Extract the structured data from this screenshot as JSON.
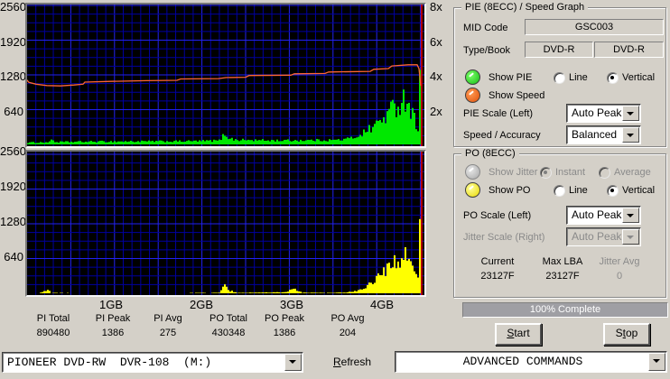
{
  "window": {
    "bg": "#d4d0c8",
    "accent_green": "#00e800",
    "accent_yellow": "#ffff00",
    "speed_line_color": "#ff6633",
    "cursor_color": "#dd0000"
  },
  "chart_data": [
    {
      "id": "pie_speed_graph",
      "type": "bar+line",
      "title": "PIE (8ECC) / Speed Graph",
      "bg": "#000000",
      "grid": {
        "on": true,
        "minor_color": "#0000a0",
        "major_color": "#2222f0"
      },
      "x_axis": {
        "unit": "GB",
        "range": [
          0,
          4.45
        ],
        "ticks": [
          "1GB",
          "2GB",
          "3GB",
          "4GB"
        ],
        "tick_values": [
          1,
          2,
          3,
          4
        ]
      },
      "left_axis": {
        "series": "PIE",
        "range": [
          0,
          2560
        ],
        "ticks": [
          2560,
          1920,
          1280,
          640
        ]
      },
      "right_axis": {
        "series": "Speed",
        "range": [
          2,
          8
        ],
        "ticks": [
          "8x",
          "6x",
          "4x",
          "2x"
        ]
      },
      "cursor_gb": 4.45,
      "bars": {
        "name": "PIE",
        "color": "#00e800",
        "peak": 1386,
        "keypoints_gb_value": [
          [
            0,
            25
          ],
          [
            0.05,
            35
          ],
          [
            0.25,
            40
          ],
          [
            0.32,
            45
          ],
          [
            0.35,
            115
          ],
          [
            0.38,
            45
          ],
          [
            0.6,
            50
          ],
          [
            0.9,
            55
          ],
          [
            1.3,
            58
          ],
          [
            1.7,
            60
          ],
          [
            2.0,
            65
          ],
          [
            2.2,
            75
          ],
          [
            2.26,
            200
          ],
          [
            2.3,
            140
          ],
          [
            2.36,
            90
          ],
          [
            2.6,
            80
          ],
          [
            2.9,
            75
          ],
          [
            3.2,
            80
          ],
          [
            3.5,
            85
          ],
          [
            3.6,
            100
          ],
          [
            3.7,
            140
          ],
          [
            3.8,
            230
          ],
          [
            3.9,
            340
          ],
          [
            4.0,
            480
          ],
          [
            4.1,
            650
          ],
          [
            4.2,
            830
          ],
          [
            4.27,
            900
          ],
          [
            4.31,
            760
          ],
          [
            4.35,
            520
          ],
          [
            4.39,
            360
          ],
          [
            4.41,
            340
          ],
          [
            4.418,
            1386
          ],
          [
            4.428,
            1386
          ],
          [
            4.434,
            700
          ],
          [
            4.44,
            60
          ]
        ]
      },
      "line": {
        "name": "Speed",
        "color": "#ff6633",
        "points_gb_speed": [
          [
            0,
            4.65
          ],
          [
            0.02,
            4.3
          ],
          [
            0.05,
            3.9
          ],
          [
            0.1,
            3.6
          ],
          [
            0.18,
            3.5
          ],
          [
            0.3,
            3.42
          ],
          [
            0.45,
            3.4
          ],
          [
            0.6,
            3.45
          ],
          [
            0.7,
            3.5
          ],
          [
            0.72,
            3.62
          ],
          [
            1.0,
            3.66
          ],
          [
            1.4,
            3.7
          ],
          [
            1.74,
            3.72
          ],
          [
            1.78,
            3.8
          ],
          [
            2.2,
            3.82
          ],
          [
            2.28,
            3.88
          ],
          [
            2.5,
            3.9
          ],
          [
            2.54,
            4.0
          ],
          [
            3.0,
            4.02
          ],
          [
            3.04,
            4.1
          ],
          [
            3.38,
            4.12
          ],
          [
            3.42,
            4.2
          ],
          [
            3.88,
            4.24
          ],
          [
            3.92,
            4.36
          ],
          [
            4.08,
            4.4
          ],
          [
            4.12,
            4.55
          ],
          [
            4.3,
            4.62
          ],
          [
            4.4,
            4.62
          ],
          [
            4.42,
            4.4
          ],
          [
            4.44,
            3.4
          ]
        ]
      }
    },
    {
      "id": "po_graph",
      "type": "bar",
      "title": "PO (8ECC)",
      "bg": "#000000",
      "grid": {
        "on": true,
        "minor_color": "#0000a0",
        "major_color": "#2222f0"
      },
      "x_axis": {
        "unit": "GB",
        "range": [
          0,
          4.45
        ],
        "ticks": [
          "1GB",
          "2GB",
          "3GB",
          "4GB"
        ],
        "tick_values": [
          1,
          2,
          3,
          4
        ]
      },
      "left_axis": {
        "series": "PO",
        "range": [
          0,
          2560
        ],
        "ticks": [
          2560,
          1920,
          1280,
          640
        ]
      },
      "cursor_gb": 4.45,
      "bars": {
        "name": "PO",
        "color": "#ffff00",
        "peak": 1386,
        "keypoints_gb_value": [
          [
            0,
            3
          ],
          [
            0.2,
            4
          ],
          [
            0.28,
            55
          ],
          [
            0.31,
            60
          ],
          [
            0.34,
            8
          ],
          [
            0.7,
            3
          ],
          [
            1.2,
            4
          ],
          [
            1.8,
            5
          ],
          [
            2.2,
            10
          ],
          [
            2.26,
            150
          ],
          [
            2.3,
            60
          ],
          [
            2.4,
            8
          ],
          [
            2.95,
            20
          ],
          [
            3.0,
            95
          ],
          [
            3.06,
            55
          ],
          [
            3.12,
            12
          ],
          [
            3.4,
            8
          ],
          [
            3.6,
            15
          ],
          [
            3.7,
            40
          ],
          [
            3.8,
            95
          ],
          [
            3.9,
            215
          ],
          [
            4.0,
            360
          ],
          [
            4.1,
            500
          ],
          [
            4.2,
            660
          ],
          [
            4.27,
            780
          ],
          [
            4.31,
            630
          ],
          [
            4.35,
            430
          ],
          [
            4.39,
            260
          ],
          [
            4.41,
            230
          ],
          [
            4.418,
            1386
          ],
          [
            4.428,
            1386
          ],
          [
            4.434,
            550
          ],
          [
            4.44,
            15
          ]
        ]
      }
    }
  ],
  "stats": {
    "items": [
      {
        "label": "PI Total",
        "value": "890480"
      },
      {
        "label": "PI Peak",
        "value": "1386"
      },
      {
        "label": "PI Avg",
        "value": "275"
      },
      {
        "label": "PO Total",
        "value": "430348"
      },
      {
        "label": "PO Peak",
        "value": "1386"
      },
      {
        "label": "PO Avg",
        "value": "204"
      }
    ]
  },
  "pie_group": {
    "title": "PIE (8ECC) / Speed Graph",
    "mid_code_label": "MID Code",
    "mid_code_value": "GSC003",
    "type_book_label": "Type/Book",
    "type_value": "DVD-R",
    "book_value": "DVD-R",
    "show_pie_label": "Show PIE",
    "show_speed_label": "Show Speed",
    "line_label": "Line",
    "vertical_label": "Vertical",
    "pie_style_selected": "Vertical",
    "pie_scale_label": "PIE Scale (Left)",
    "pie_scale_value": "Auto Peak",
    "speed_accuracy_label": "Speed / Accuracy",
    "speed_accuracy_value": "Balanced"
  },
  "po_group": {
    "title": "PO (8ECC)",
    "show_jitter_label": "Show Jitter",
    "instant_label": "Instant",
    "average_label": "Average",
    "jitter_mode_selected": "Instant",
    "jitter_enabled": false,
    "show_po_label": "Show PO",
    "line_label": "Line",
    "vertical_label": "Vertical",
    "po_style_selected": "Vertical",
    "po_scale_label": "PO Scale (Left)",
    "po_scale_value": "Auto Peak",
    "jitter_scale_label": "Jitter Scale (Right)",
    "jitter_scale_value": "Auto Peak",
    "current_label": "Current",
    "current_value": "23127F",
    "max_lba_label": "Max LBA",
    "max_lba_value": "23127F",
    "jitter_avg_label": "Jitter Avg",
    "jitter_avg_value": "0"
  },
  "progress": {
    "label": "100% Complete",
    "percent": 100
  },
  "buttons": {
    "start": {
      "pre": "",
      "key": "S",
      "post": "tart"
    },
    "stop": {
      "pre": "S",
      "key": "t",
      "post": "op"
    },
    "refresh": {
      "pre": "",
      "key": "R",
      "post": "efresh"
    }
  },
  "drive_select": {
    "value": "PIONEER DVD-RW  DVR-108  (M:)"
  },
  "commands_select": {
    "value": "ADVANCED COMMANDS"
  }
}
